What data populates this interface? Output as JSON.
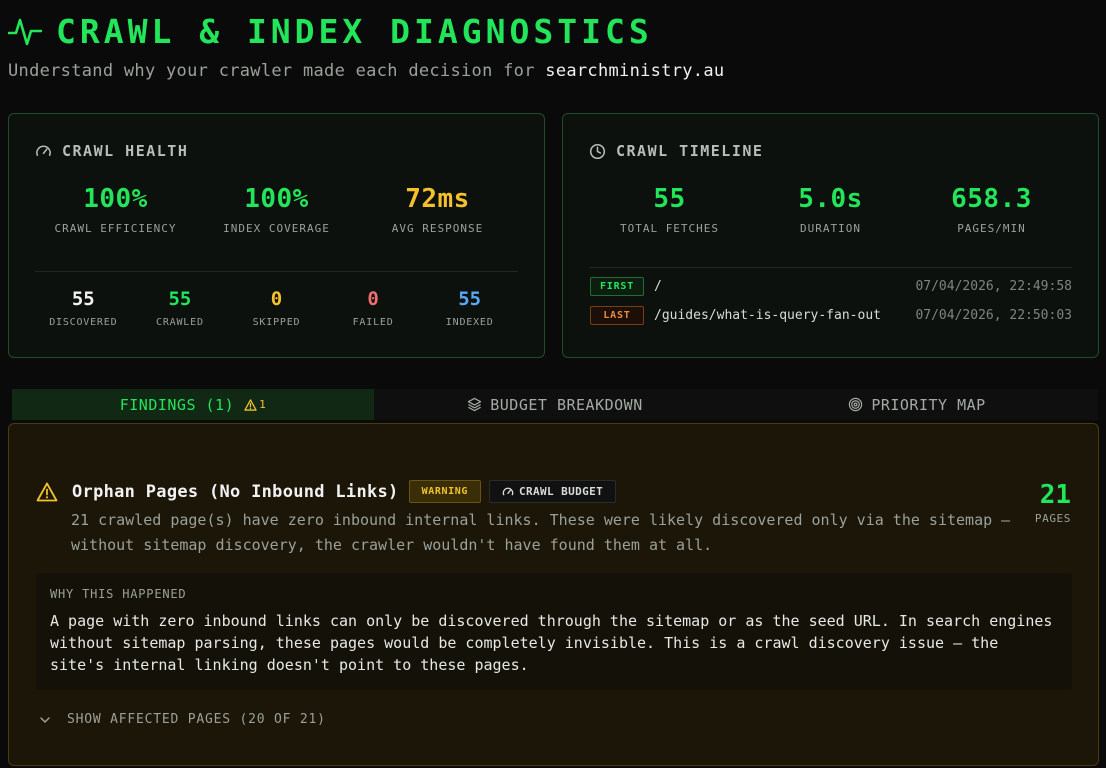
{
  "header": {
    "title": "CRAWL & INDEX DIAGNOSTICS",
    "subtitle_prefix": "Understand why your crawler made each decision for",
    "domain": "searchministry.au",
    "accent": "#22e55a"
  },
  "health": {
    "title": "CRAWL HEALTH",
    "icon": "gauge-icon",
    "big": [
      {
        "value": "100%",
        "label": "CRAWL EFFICIENCY",
        "color": "#22e55a"
      },
      {
        "value": "100%",
        "label": "INDEX COVERAGE",
        "color": "#22e55a"
      },
      {
        "value": "72ms",
        "label": "AVG RESPONSE",
        "color": "#f5c12a"
      }
    ],
    "small": [
      {
        "value": "55",
        "label": "DISCOVERED",
        "color": "#f2f2f2"
      },
      {
        "value": "55",
        "label": "CRAWLED",
        "color": "#22e55a"
      },
      {
        "value": "0",
        "label": "SKIPPED",
        "color": "#f5c12a"
      },
      {
        "value": "0",
        "label": "FAILED",
        "color": "#f26d6d"
      },
      {
        "value": "55",
        "label": "INDEXED",
        "color": "#5aa8f5"
      }
    ]
  },
  "timeline": {
    "title": "CRAWL TIMELINE",
    "icon": "clock-icon",
    "big": [
      {
        "value": "55",
        "label": "TOTAL FETCHES"
      },
      {
        "value": "5.0s",
        "label": "DURATION"
      },
      {
        "value": "658.3",
        "label": "PAGES/MIN"
      }
    ],
    "first": {
      "tag": "FIRST",
      "path": "/",
      "time": "07/04/2026, 22:49:58"
    },
    "last": {
      "tag": "LAST",
      "path": "/guides/what-is-query-fan-out",
      "time": "07/04/2026, 22:50:03"
    }
  },
  "tabs": [
    {
      "label": "FINDINGS (1)",
      "badge": "1",
      "active": true
    },
    {
      "label": "BUDGET BREAKDOWN",
      "icon": "layers-icon"
    },
    {
      "label": "PRIORITY MAP",
      "icon": "target-icon"
    }
  ],
  "finding": {
    "title": "Orphan Pages (No Inbound Links)",
    "severity": "WARNING",
    "category": "CRAWL BUDGET",
    "count": "21",
    "count_label": "PAGES",
    "description": "21 crawled page(s) have zero inbound internal links. These were likely discovered only via the sitemap — without sitemap discovery, the crawler wouldn't have found them at all.",
    "why_label": "WHY THIS HAPPENED",
    "why_text": "A page with zero inbound links can only be discovered through the sitemap or as the seed URL. In search engines without sitemap parsing, these pages would be completely invisible. This is a crawl discovery issue — the site's internal linking doesn't point to these pages.",
    "show_pages": "SHOW AFFECTED PAGES (20 OF 21)"
  }
}
